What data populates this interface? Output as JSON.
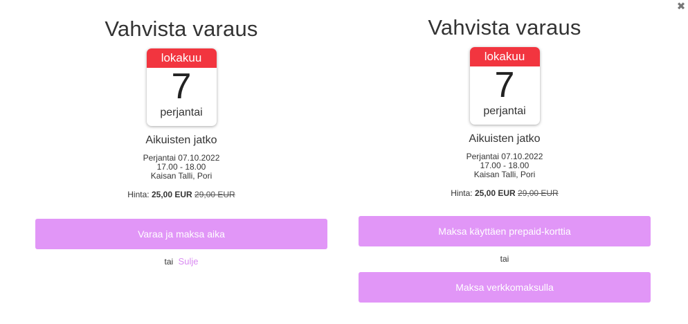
{
  "close_icon_label": "✖",
  "left": {
    "title": "Vahvista varaus",
    "calendar": {
      "month": "lokakuu",
      "day": "7",
      "weekday": "perjantai"
    },
    "event_name": "Aikuisten jatko",
    "details": {
      "date": "Perjantai 07.10.2022",
      "time": "17.00 - 18.00",
      "location": "Kaisan Talli, Pori"
    },
    "price": {
      "label": "Hinta:",
      "current": "25,00 EUR",
      "old": "29,00 EUR"
    },
    "primary_button": "Varaa ja maksa aika",
    "or_text": "tai",
    "close_link": "Sulje"
  },
  "right": {
    "title": "Vahvista varaus",
    "calendar": {
      "month": "lokakuu",
      "day": "7",
      "weekday": "perjantai"
    },
    "event_name": "Aikuisten jatko",
    "details": {
      "date": "Perjantai 07.10.2022",
      "time": "17.00 - 18.00",
      "location": "Kaisan Talli, Pori"
    },
    "price": {
      "label": "Hinta:",
      "current": "25,00 EUR",
      "old": "29,00 EUR"
    },
    "prepaid_button": "Maksa käyttäen prepaid-korttia",
    "or_text": "tai",
    "online_button": "Maksa verkkomaksulla"
  },
  "colors": {
    "button": "#e196f7",
    "calendar_header": "#f2353f",
    "link": "#d98bf1"
  }
}
